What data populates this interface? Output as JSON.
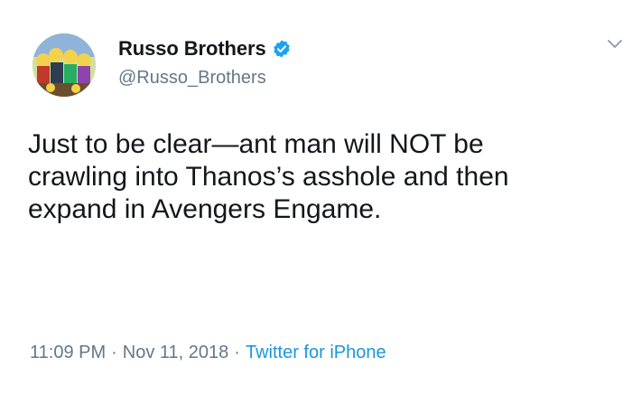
{
  "account": {
    "display_name": "Russo Brothers",
    "handle": "@Russo_Brothers",
    "verified": true,
    "avatar_icon": "avatar-image",
    "verified_color": "#1da1f2"
  },
  "tweet": {
    "lines": [
      "Just to be clear—ant man will NOT be",
      "crawling into Thanos’s asshole and then",
      "expand in Avengers Engame."
    ],
    "time": "11:09 PM",
    "date": "Nov 11, 2018",
    "separator": "·",
    "source": "Twitter for iPhone"
  },
  "icons": {
    "more_menu": "chevron-down-icon",
    "verified": "verified-badge-icon"
  },
  "colors": {
    "text": "#14171a",
    "muted": "#657786",
    "link": "#1b95e0"
  }
}
